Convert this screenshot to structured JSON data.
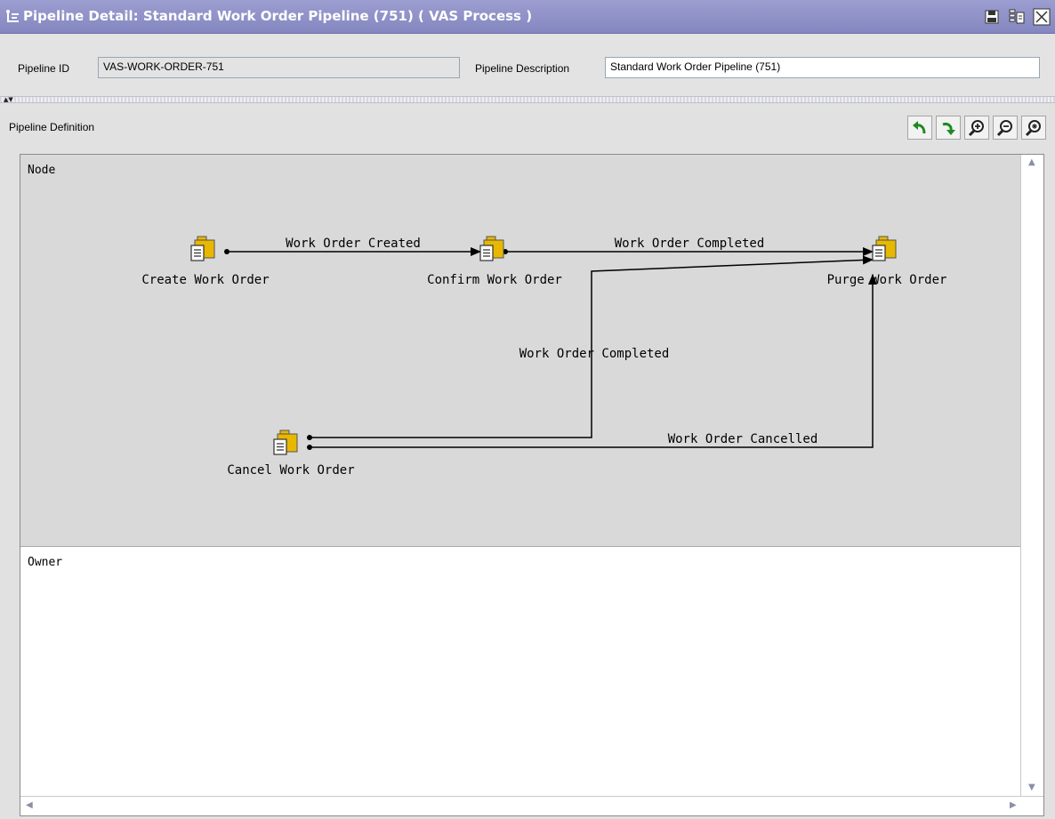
{
  "window": {
    "title": "Pipeline Detail: Standard Work Order Pipeline (751) ( VAS Process )",
    "title_icon": "pipeline-icon",
    "buttons": [
      "save-icon",
      "details-icon",
      "close-icon"
    ]
  },
  "header": {
    "pipeline_id_label": "Pipeline ID",
    "pipeline_id_value": "VAS-WORK-ORDER-751",
    "pipeline_description_label": "Pipeline Description",
    "pipeline_description_value": "Standard Work Order Pipeline (751)"
  },
  "definition": {
    "section_title": "Pipeline Definition",
    "toolbar": [
      "undo-icon",
      "redo-icon",
      "zoom-in-icon",
      "zoom-out-icon",
      "zoom-fit-icon"
    ]
  },
  "lanes": {
    "node_label": "Node",
    "owner_label": "Owner"
  },
  "diagram": {
    "nodes": [
      {
        "id": "create",
        "label": "Create Work Order"
      },
      {
        "id": "confirm",
        "label": "Confirm Work Order"
      },
      {
        "id": "purge",
        "label": "Purge Work Order"
      },
      {
        "id": "cancel",
        "label": "Cancel Work Order"
      }
    ],
    "transitions": [
      {
        "from": "create",
        "to": "confirm",
        "label": "Work Order Created"
      },
      {
        "from": "confirm",
        "to": "purge",
        "label": "Work Order Completed"
      },
      {
        "from": "cancel",
        "to": "purge",
        "label": "Work Order Completed"
      },
      {
        "from": "cancel",
        "to": "purge",
        "label": "Work Order Cancelled"
      }
    ]
  },
  "colors": {
    "titlebar": "#8f91c8",
    "node_lane": "#d9d9d9",
    "node_icon": "#e8b800"
  }
}
